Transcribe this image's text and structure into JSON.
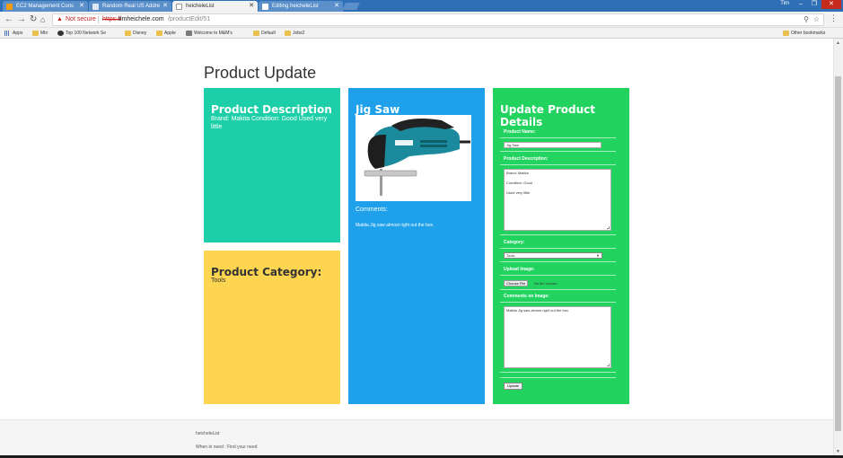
{
  "browser": {
    "tabs": [
      {
        "label": "EC2 Management Cons",
        "active": false
      },
      {
        "label": "Random Real US Addre",
        "active": false
      },
      {
        "label": "heicheleList",
        "active": true
      },
      {
        "label": "Editing heicheleList",
        "active": false
      }
    ],
    "user": "Tim",
    "security_label": "Not secure",
    "url_scheme": "https://",
    "url_host": "timheichele.com",
    "url_path": "/productEdit/51",
    "bookmarks": [
      "Apps",
      "Mtn",
      "Top 100 Network Se",
      "Disney",
      "Apple",
      "Welcome to M&M’s",
      "Default",
      "Jobs2"
    ],
    "other_bookmarks": "Other bookmarks"
  },
  "page": {
    "title": "Product Update"
  },
  "description_panel": {
    "heading": "Product Description",
    "text": "Brand: Makita Condition: Good Used very little"
  },
  "category_panel": {
    "heading": "Product Category:",
    "value": "Tools"
  },
  "item_panel": {
    "name": "Jig Saw",
    "comments_label": "Comments:",
    "comments_text": "Makita Jig saw almost right out the box."
  },
  "form": {
    "heading": "Update Product Details",
    "name_label": "Product Name:",
    "name_value": "Jig Saw",
    "description_label": "Product Description:",
    "description_lines": [
      "Brand: Makita",
      "Condition: Good",
      "Used very little"
    ],
    "category_label": "Category:",
    "category_value": "Tools",
    "upload_label": "Upload Image:",
    "choose_file": "Choose File",
    "no_file": "No file chosen",
    "comments_label": "Comments on Image:",
    "comments_value": "Makita Jig saw almost right out the box.",
    "submit": "Update"
  },
  "footer": {
    "brand": "heicheleList",
    "tagline": "When in need : Find your need"
  },
  "colors": {
    "description": "#1ccfa8",
    "category": "#fed550",
    "item": "#1ea0ea",
    "form": "#22d35f",
    "tabbar": "#2e6fb5"
  }
}
